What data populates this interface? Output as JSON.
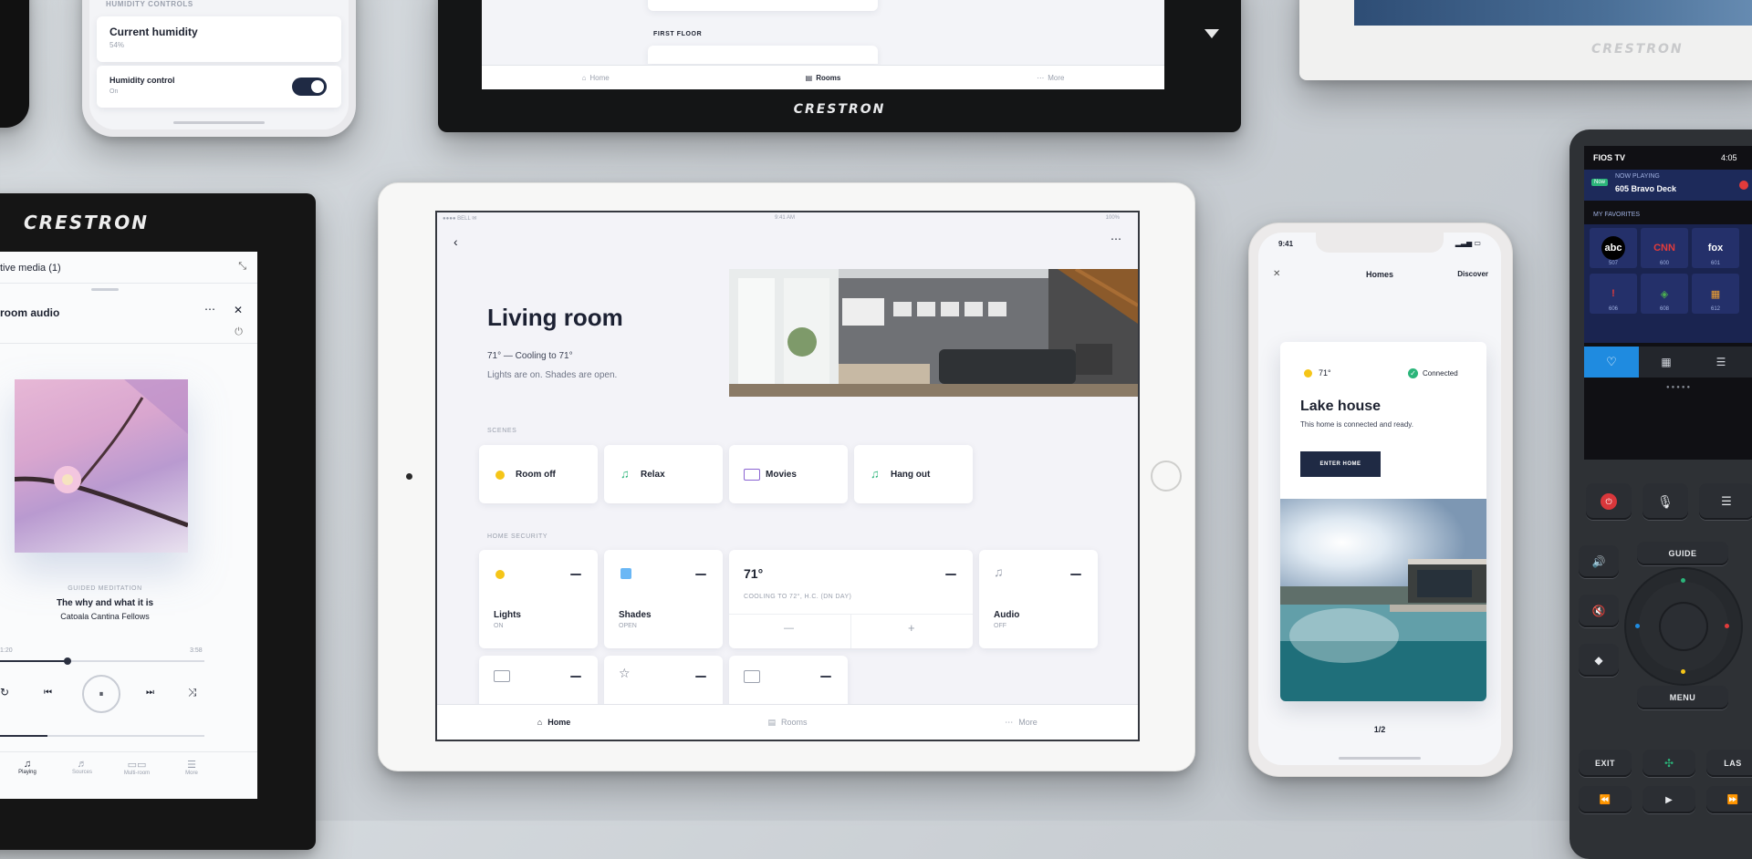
{
  "top_phone": {
    "section_label": "HUMIDITY CONTROLS",
    "current_humidity_label": "Current humidity",
    "current_humidity_value": "54%",
    "humidity_control_label": "Humidity control",
    "humidity_control_value": "On"
  },
  "top_tablet": {
    "floor_label": "FIRST FLOOR",
    "tabs": [
      "Home",
      "Rooms",
      "More"
    ],
    "brand": "CRESTRON"
  },
  "top_right_panel": {
    "brand": "CRESTRON"
  },
  "left_panel": {
    "brand": "CRESTRON",
    "header": "tive media (1)",
    "subheader": "room audio",
    "track_tag": "GUIDED MEDITATION",
    "track_title": "The why and what it is",
    "track_artist": "Catoala Cantina Fellows",
    "time_start": "1:20",
    "time_end": "3:58",
    "nav": [
      "Playing",
      "Sources",
      "Multi-room",
      "More"
    ]
  },
  "ipad": {
    "status_left": "●●●● BELL ✉",
    "status_time": "9:41 AM",
    "status_right": "100%",
    "title": "Living room",
    "subtitle_line1": "71° — Cooling to 71°",
    "subtitle_line2": "Lights are on. Shades are open.",
    "scenes_label": "SCENES",
    "scenes": [
      {
        "label": "Room off",
        "icon": "sun-icon"
      },
      {
        "label": "Relax",
        "icon": "music-note-icon"
      },
      {
        "label": "Movies",
        "icon": "movie-icon"
      },
      {
        "label": "Hang out",
        "icon": "music-note-icon"
      }
    ],
    "security_label": "HOME SECURITY",
    "tiles": [
      {
        "label": "Lights",
        "status": "ON",
        "icon": "sun-icon"
      },
      {
        "label": "Shades",
        "status": "OPEN",
        "icon": "shades-icon"
      },
      {
        "label": "Audio",
        "status": "OFF",
        "icon": "music-note-icon"
      }
    ],
    "climate": {
      "temp": "71°",
      "status": "COOLING TO 72°, H.C. (DN DAY)",
      "minus": "—",
      "plus": "+"
    },
    "bottom_tabs": [
      "Home",
      "Rooms",
      "More"
    ]
  },
  "iphone": {
    "time": "9:41",
    "close": "✕",
    "title": "Homes",
    "action": "Discover",
    "temp": "71°",
    "connection": "Connected",
    "home_name": "Lake house",
    "home_desc": "This home is connected and ready.",
    "button": "ENTER HOME",
    "pager": "1/2"
  },
  "remote": {
    "provider": "FIOS TV",
    "time": "4:05",
    "now_playing_tag": "Now",
    "now_playing_label": "NOW PLAYING",
    "now_playing_title": "605 Bravo Deck",
    "favorites_label": "MY FAVORITES",
    "channels": [
      {
        "name": "abc",
        "num": "507"
      },
      {
        "name": "CNN",
        "num": "600"
      },
      {
        "name": "fox",
        "num": "601"
      },
      {
        "name": "!",
        "num": "606"
      },
      {
        "name": "◈",
        "num": "608"
      },
      {
        "name": "▦",
        "num": "612"
      }
    ],
    "keys": {
      "guide": "GUIDE",
      "menu": "MENU",
      "exit": "EXIT",
      "last": "LAS"
    },
    "accent": "#1f8be0"
  }
}
